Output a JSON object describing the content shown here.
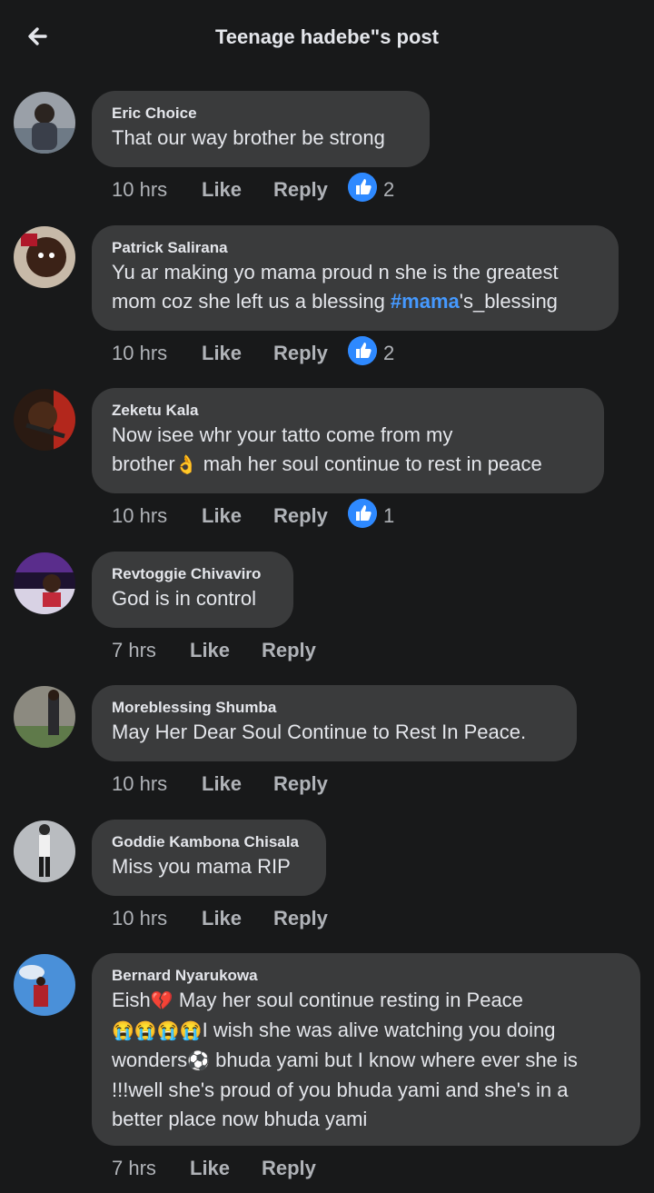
{
  "header": {
    "title": "Teenage hadebe\"s post",
    "back_icon": "arrow-left-icon"
  },
  "colors": {
    "background": "#18191a",
    "bubble": "#3a3b3c",
    "text": "#e4e6eb",
    "muted": "#b0b3b8",
    "link": "#4599ff",
    "like_reaction": "#2e89ff"
  },
  "comments": [
    {
      "author": "Eric Choice",
      "text": "That our way brother be strong",
      "time": "10 hrs",
      "like": "Like",
      "reply": "Reply",
      "reactions": "2"
    },
    {
      "author": "Patrick Salirana",
      "text_a": "Yu ar making yo mama proud n she is the greatest\nmom coz she left us a blessing ",
      "hashtag": "#mama",
      "text_b": "'s_blessing",
      "time": "10 hrs",
      "like": "Like",
      "reply": "Reply",
      "reactions": "2"
    },
    {
      "author": "Zeketu Kala",
      "text_a": "Now isee whr your tatto come from my\nbrother",
      "emoji": "👌",
      "text_b": " mah her soul continue to rest in peace",
      "time": "10 hrs",
      "like": "Like",
      "reply": "Reply",
      "reactions": "1"
    },
    {
      "author": "Revtoggie Chivaviro",
      "text": "God is in control",
      "time": "7 hrs",
      "like": "Like",
      "reply": "Reply"
    },
    {
      "author": "Moreblessing Shumba",
      "text": "May Her Dear Soul Continue to Rest In Peace.",
      "time": "10 hrs",
      "like": "Like",
      "reply": "Reply"
    },
    {
      "author": "Goddie Kambona Chisala",
      "text": "Miss you mama RIP",
      "time": "10 hrs",
      "like": "Like",
      "reply": "Reply"
    },
    {
      "author": "Bernard Nyarukowa",
      "t1": "Eish",
      "e1": "💔",
      "t2": " May her soul continue resting in Peace",
      "e2": "😭😭😭😭",
      "t3": "I wish she was alive watching you doing",
      "t4": "wonders",
      "e3": "⚽",
      "t5": " bhuda yami but I know where ever she is\n!!!well she's proud of you bhuda yami and she's in a\nbetter place now bhuda yami",
      "time": "7 hrs",
      "like": "Like",
      "reply": "Reply"
    }
  ]
}
